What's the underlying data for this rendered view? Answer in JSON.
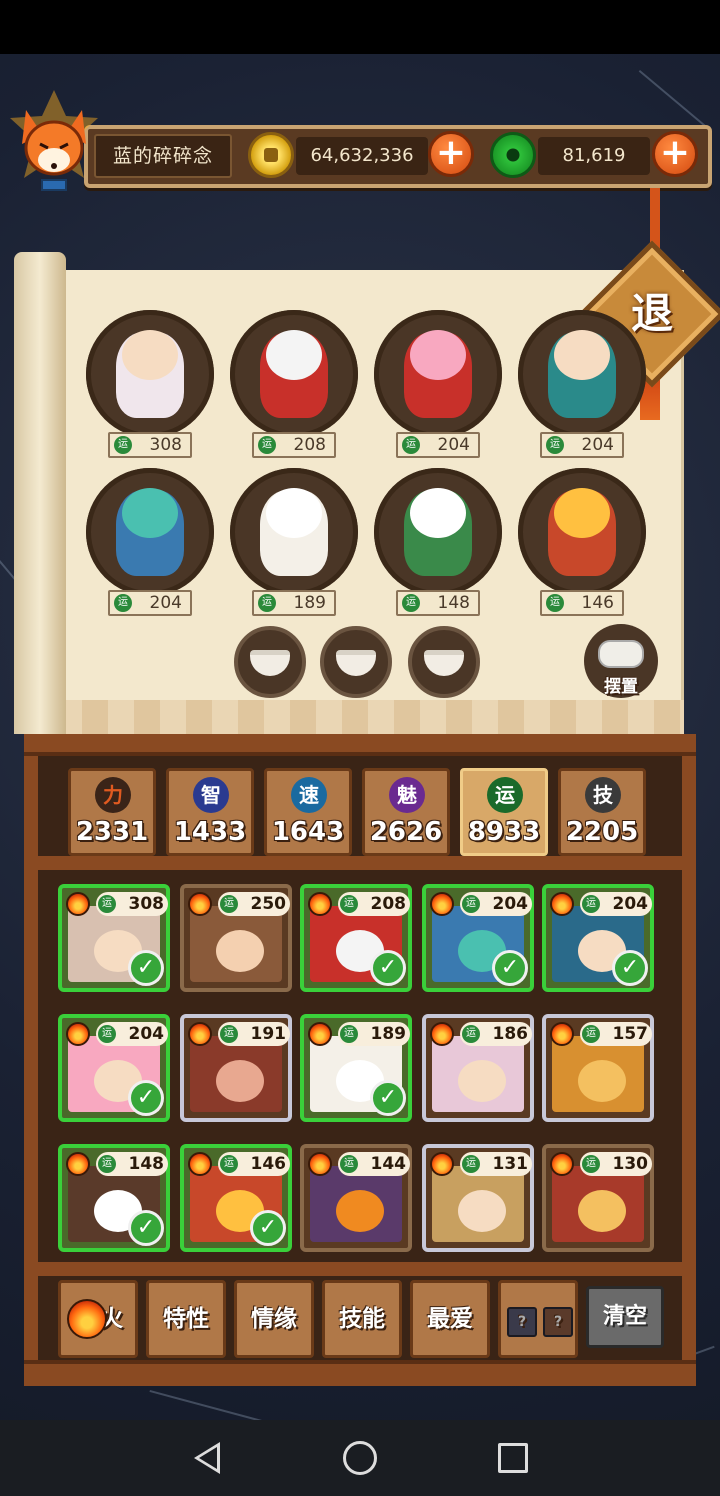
{
  "header": {
    "username": "蓝的碎碎念",
    "coins": "64,632,336",
    "jade": "81,619",
    "exit_label": "退"
  },
  "team": {
    "luck_icon_label": "运",
    "members": [
      {
        "luck": "308"
      },
      {
        "luck": "208"
      },
      {
        "luck": "204"
      },
      {
        "luck": "204"
      },
      {
        "luck": "204"
      },
      {
        "luck": "189"
      },
      {
        "luck": "148"
      },
      {
        "luck": "146"
      }
    ],
    "gamepad_label": "摆置"
  },
  "stats": [
    {
      "icon": "力",
      "value": "2331",
      "color": "#c83a10"
    },
    {
      "icon": "智",
      "value": "1433",
      "color": "#3a4ab0"
    },
    {
      "icon": "速",
      "value": "1643",
      "color": "#2a8ac8"
    },
    {
      "icon": "魅",
      "value": "2626",
      "color": "#8a3ab0"
    },
    {
      "icon": "运",
      "value": "8933",
      "color": "#2a8a3a"
    },
    {
      "icon": "技",
      "value": "2205",
      "color": "#4a4a4a"
    }
  ],
  "cards": [
    {
      "luck": "308"
    },
    {
      "luck": "250"
    },
    {
      "luck": "208"
    },
    {
      "luck": "204"
    },
    {
      "luck": "204"
    },
    {
      "luck": "204"
    },
    {
      "luck": "191"
    },
    {
      "luck": "189"
    },
    {
      "luck": "186"
    },
    {
      "luck": "157"
    },
    {
      "luck": "148"
    },
    {
      "luck": "146"
    },
    {
      "luck": "144"
    },
    {
      "luck": "131"
    },
    {
      "luck": "130"
    }
  ],
  "filters": {
    "fire": "火",
    "trait": "特性",
    "bond": "情缘",
    "skill": "技能",
    "favorite": "最爱",
    "unknown": "?",
    "clear": "清空"
  }
}
